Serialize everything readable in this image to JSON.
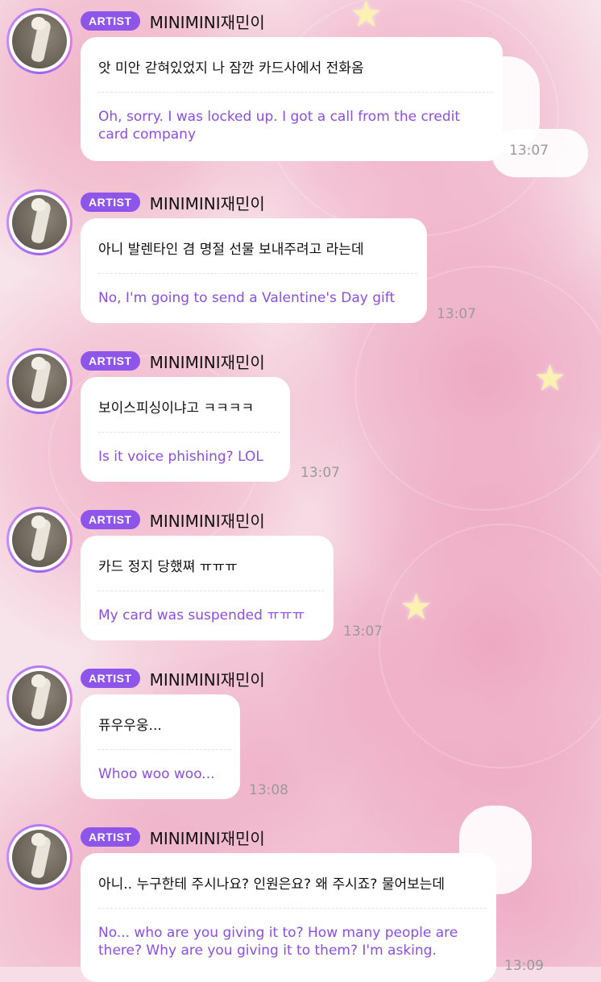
{
  "messages": [
    {
      "badge": "ARTIST",
      "sender": "MINIMINI재민이",
      "korean": "앗 미안 갇혀있었지 나 잠깐 카드사에서 전화옴",
      "english": "Oh, sorry. I was locked up. I got a call from the credit card company",
      "time": "13:07"
    },
    {
      "badge": "ARTIST",
      "sender": "MINIMINI재민이",
      "korean": "아니 발렌타인 겸 명절 선물 보내주려고 라는데",
      "english": "No, I'm going to send a Valentine's Day gift",
      "time": "13:07"
    },
    {
      "badge": "ARTIST",
      "sender": "MINIMINI재민이",
      "korean": "보이스피싱이냐고 ㅋㅋㅋㅋ",
      "english": "Is it voice phishing? LOL",
      "time": "13:07"
    },
    {
      "badge": "ARTIST",
      "sender": "MINIMINI재민이",
      "korean": "카드 정지 당했쪄 ㅠㅠㅠ",
      "english": "My card was suspended ㅠㅠㅠ",
      "time": "13:07"
    },
    {
      "badge": "ARTIST",
      "sender": "MINIMINI재민이",
      "korean": "퓨우우웅...",
      "english": "Whoo woo woo...",
      "time": "13:08"
    },
    {
      "badge": "ARTIST",
      "sender": "MINIMINI재민이",
      "korean": "아니.. 누구한테 주시나요? 인원은요? 왜 주시죠? 물어보는데",
      "english": "No... who are you giving it to? How many people are there? Why are you giving it to them? I'm asking.",
      "time": "13:09"
    }
  ]
}
